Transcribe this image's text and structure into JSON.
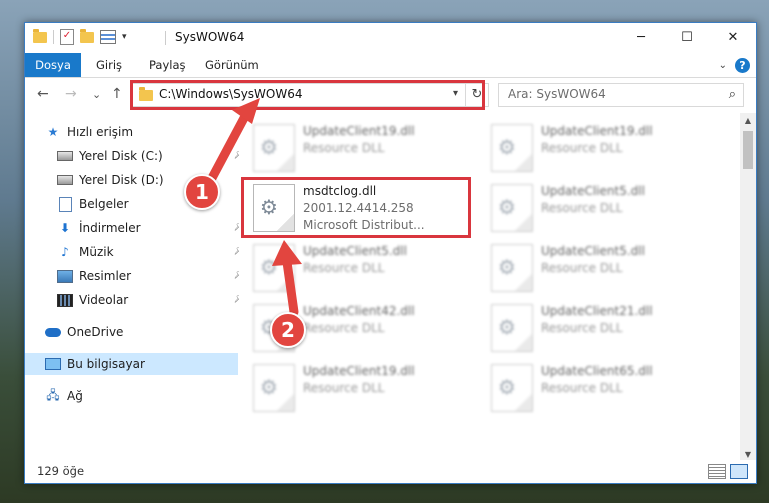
{
  "window": {
    "title": "SysWOW64",
    "controls": {
      "minimize": "─",
      "maximize": "☐",
      "close": "✕"
    }
  },
  "ribbon": {
    "tabs": [
      "Dosya",
      "Giriş",
      "Paylaş",
      "Görünüm"
    ],
    "help_label": "?"
  },
  "nav": {
    "back": "←",
    "forward": "→",
    "recent": "⌄",
    "up": "↑",
    "address": "C:\\Windows\\SysWOW64",
    "search_placeholder": "Ara: SysWOW64"
  },
  "sidebar": {
    "items": [
      {
        "label": "Hızlı erişim",
        "icon": "star-icon"
      },
      {
        "label": "Yerel Disk (C:)",
        "icon": "drive-icon",
        "pinned": true
      },
      {
        "label": "Yerel Disk (D:)",
        "icon": "drive-icon"
      },
      {
        "label": "Belgeler",
        "icon": "documents-icon"
      },
      {
        "label": "İndirmeler",
        "icon": "download-icon",
        "pinned": true
      },
      {
        "label": "Müzik",
        "icon": "music-icon",
        "pinned": true
      },
      {
        "label": "Resimler",
        "icon": "pictures-icon",
        "pinned": true
      },
      {
        "label": "Videolar",
        "icon": "videos-icon",
        "pinned": true
      },
      {
        "label": "OneDrive",
        "icon": "cloud-icon"
      },
      {
        "label": "Bu bilgisayar",
        "icon": "computer-icon",
        "selected": true
      },
      {
        "label": "Ağ",
        "icon": "network-icon"
      }
    ]
  },
  "files": [
    {
      "name": "UpdateClient19.dll",
      "sub": "Resource DLL"
    },
    {
      "name": "UpdateClient19.dll",
      "sub": "Resource DLL"
    },
    {
      "name": "msdtclog.dll",
      "sub": "2001.12.4414.258",
      "sub2": "Microsoft Distribut..."
    },
    {
      "name": "UpdateClient5.dll",
      "sub": "Resource DLL"
    },
    {
      "name": "UpdateClient5.dll",
      "sub": "Resource DLL"
    },
    {
      "name": "UpdateClient5.dll",
      "sub": "Resource DLL"
    },
    {
      "name": "UpdateClient42.dll",
      "sub": "Resource DLL"
    },
    {
      "name": "UpdateClient21.dll",
      "sub": "Resource DLL"
    },
    {
      "name": "UpdateClient19.dll",
      "sub": "Resource DLL"
    },
    {
      "name": "UpdateClient65.dll",
      "sub": "Resource DLL"
    }
  ],
  "status": {
    "count": "129 öğe"
  },
  "callouts": {
    "one": "1",
    "two": "2"
  },
  "colors": {
    "accent": "#1979ca",
    "highlight": "#d9363e",
    "callout": "#e2453f",
    "selected": "#cce8ff"
  }
}
